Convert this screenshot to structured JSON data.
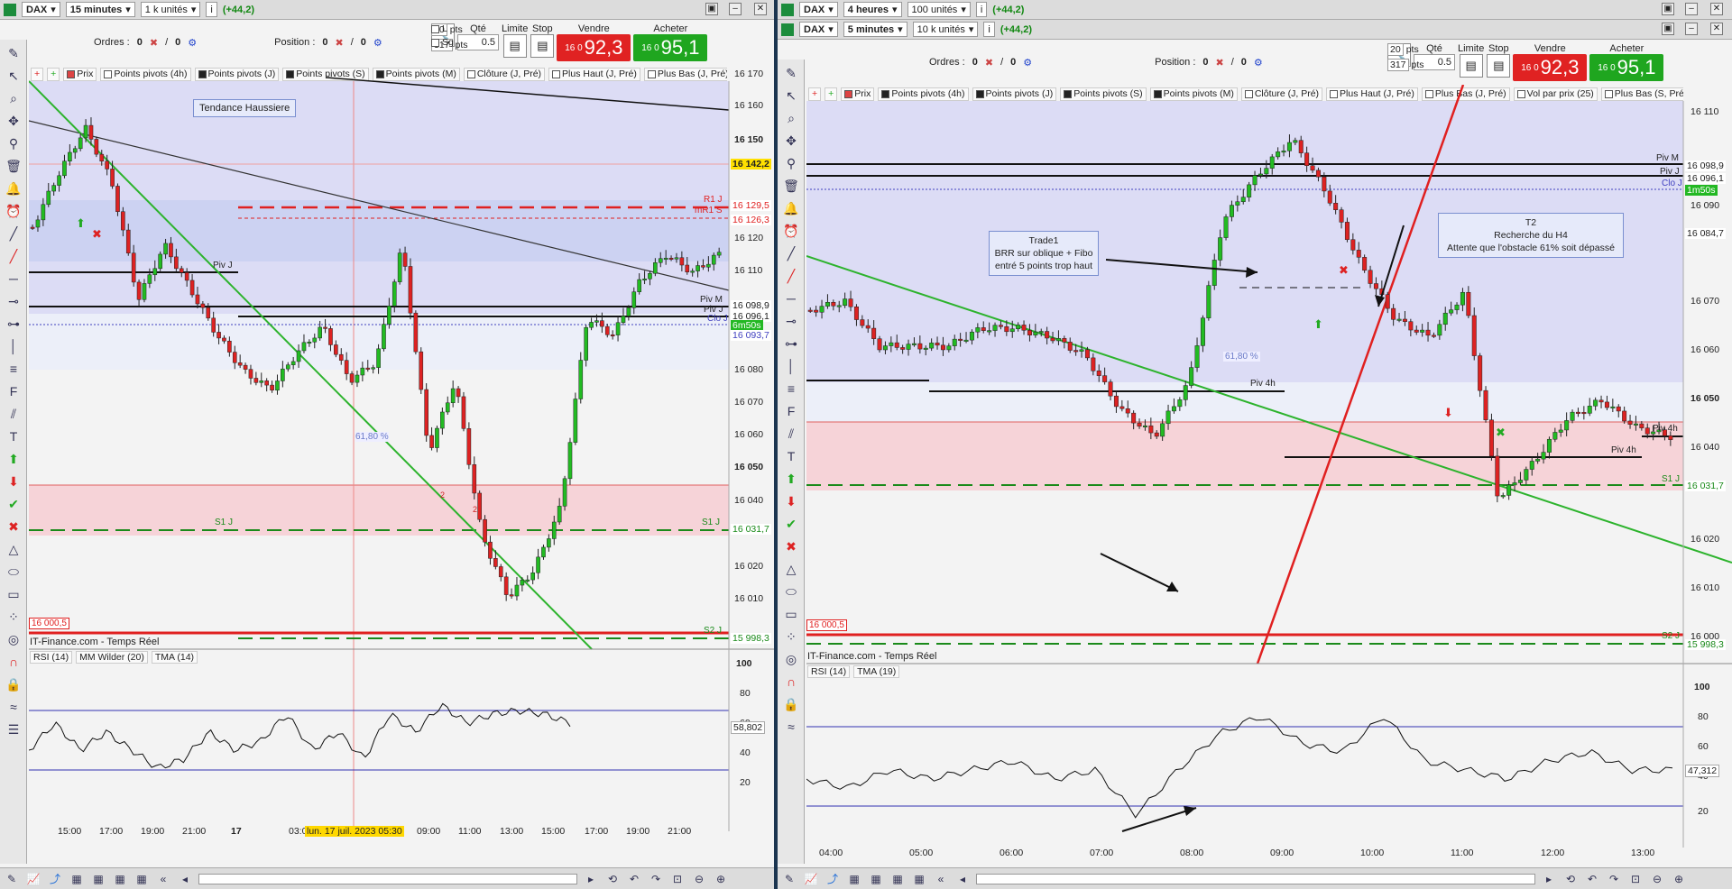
{
  "left": {
    "instrument": "DAX",
    "timeframe": "15 minutes",
    "units": "1 k unités",
    "change": "(+44,2)",
    "orders_label": "Ordres :",
    "orders_a": "0",
    "orders_b": "0",
    "position_label": "Position :",
    "position_a": "0",
    "position_b": "0",
    "qty_label": "Qté",
    "qty_value": "0.5",
    "limit_label": "Limite",
    "stop_label": "Stop",
    "sell_label": "Vendre",
    "buy_label": "Acheter",
    "sell_small": "16 0",
    "sell_big": "92,3",
    "buy_small": "16 0",
    "buy_big": "95,1",
    "pts1": "20",
    "pts2": "317",
    "pts_unit": "pts",
    "opt_l": "L",
    "opt_sg": "Sg",
    "legend": [
      "Prix",
      "Points pivots (4h)",
      "Points pivots (J)",
      "Points pivots (S)",
      "Points pivots (M)",
      "Clôture (J, Pré)",
      "Plus Haut (J, Pré)",
      "Plus Bas (J, Pré)"
    ],
    "source": "IT-Finance.com - Temps Réel",
    "rsi_legend": [
      "RSI (14)",
      "MM Wilder (20)",
      "TMA (14)"
    ],
    "price_ticks": [
      "16 170",
      "16 160",
      "16 150",
      "16 120",
      "16 110",
      "16 080",
      "16 070",
      "16 060",
      "16 050",
      "16 040",
      "16 020",
      "16 010"
    ],
    "rsi_ticks": [
      "100",
      "80",
      "60",
      "40",
      "20"
    ],
    "time_ticks": [
      "15:00",
      "17:00",
      "19:00",
      "21:00",
      "17",
      "03:0",
      "09:00",
      "11:00",
      "13:00",
      "15:00",
      "17:00",
      "19:00",
      "21:00"
    ],
    "crosshair_date": "lun. 17 juil. 2023 05:30",
    "labels": {
      "tendance": "Tendance Haussiere",
      "pivj1": "Piv J",
      "pivm": "Piv M",
      "pivj2": "Piv J",
      "cloj": "Clo J",
      "r1j": "R1 J",
      "mr1s": "mR1 S",
      "s1j": "S1 J",
      "s1j2": "S1 J",
      "s2j": "S2 J",
      "fib": "61,80 %",
      "lvl16000": "16 000,5",
      "cnt2a": "2",
      "cnt2b": "2"
    },
    "tags": {
      "p16142": "16 142,2",
      "p16129": "16 129,5",
      "p16126": "16 126,3",
      "p16098": "16 098,9",
      "p16096": "16 096,1",
      "p16093": "16 093,7",
      "timer": "6m50s",
      "p16031": "16 031,7",
      "p15998": "15 998,3",
      "rsi": "58,802"
    }
  },
  "right": {
    "instrument": "DAX",
    "timeframe1": "4 heures",
    "units1": "100 unités",
    "change1": "(+44,2)",
    "timeframe2": "5 minutes",
    "units2": "10 k unités",
    "change2": "(+44,2)",
    "orders_label": "Ordres :",
    "orders_a": "0",
    "orders_b": "0",
    "position_label": "Position :",
    "position_a": "0",
    "position_b": "0",
    "qty_label": "Qté",
    "qty_value": "0.5",
    "limit_label": "Limite",
    "stop_label": "Stop",
    "sell_label": "Vendre",
    "buy_label": "Acheter",
    "sell_small": "16 0",
    "sell_big": "92,3",
    "buy_small": "16 0",
    "buy_big": "95,1",
    "pts1": "20",
    "pts2": "317",
    "pts_unit": "pts",
    "opt_l": "L",
    "opt_sg": "Sg",
    "legend": [
      "Prix",
      "Points pivots (4h)",
      "Points pivots (J)",
      "Points pivots (S)",
      "Points pivots (M)",
      "Clôture (J, Pré)",
      "Plus Haut (J, Pré)",
      "Plus Bas (J, Pré)",
      "Vol par prix (25)",
      "Plus Bas (S, Pré)"
    ],
    "source": "IT-Finance.com - Temps Réel",
    "rsi_legend": [
      "RSI (14)",
      "TMA (19)"
    ],
    "price_ticks": [
      "16 110",
      "16 090",
      "16 070",
      "16 060",
      "16 050",
      "16 040",
      "16 020",
      "16 010",
      "16 000"
    ],
    "rsi_ticks": [
      "100",
      "80",
      "60",
      "40",
      "20"
    ],
    "time_ticks": [
      "04:00",
      "05:00",
      "06:00",
      "07:00",
      "08:00",
      "09:00",
      "10:00",
      "11:00",
      "12:00",
      "13:00"
    ],
    "labels": {
      "pivm": "Piv M",
      "pivj": "Piv J",
      "cloj": "Clo J",
      "piv4h1": "Piv 4h",
      "piv4h2": "Piv 4h",
      "piv4h3": "Piv 4h",
      "s1j": "S1 J",
      "s2j": "S2 J",
      "fib": "61,80 %",
      "lvl16000": "16 000,5"
    },
    "trade1": [
      "Trade1",
      "BRR sur oblique + Fibo",
      "entré 5 points trop haut"
    ],
    "t2": [
      "T2",
      "Recherche du H4",
      "Attente que l'obstacle 61% soit dépassé"
    ],
    "tags": {
      "p16098": "16 098,9",
      "p16096": "16 096,1",
      "timer": "1m50s",
      "p16084": "16 084,7",
      "p16031": "16 031,7",
      "p15998": "15 998,3",
      "rsi": "47,312"
    }
  },
  "colors": {
    "sell": "#e02222",
    "buy": "#1fa61f",
    "bull": "#22bb22",
    "bear": "#dd2222",
    "zone_blue": "#dcdcf5",
    "zone_red": "#f6d3d8"
  }
}
